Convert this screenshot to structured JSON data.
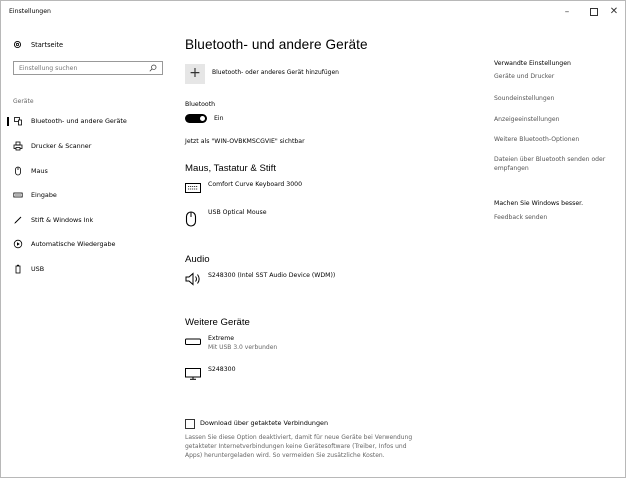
{
  "window": {
    "title": "Einstellungen",
    "controls": {
      "minimize": "–",
      "close": "✕"
    }
  },
  "sidebar": {
    "home_label": "Startseite",
    "search_placeholder": "Einstellung suchen",
    "section_label": "Geräte",
    "items": [
      {
        "label": "Bluetooth- und andere Geräte",
        "icon": "bluetooth-devices-icon",
        "selected": true
      },
      {
        "label": "Drucker & Scanner",
        "icon": "printer-icon",
        "selected": false
      },
      {
        "label": "Maus",
        "icon": "mouse-icon",
        "selected": false
      },
      {
        "label": "Eingabe",
        "icon": "keyboard-icon",
        "selected": false
      },
      {
        "label": "Stift & Windows Ink",
        "icon": "pen-icon",
        "selected": false
      },
      {
        "label": "Automatische Wiedergabe",
        "icon": "autoplay-icon",
        "selected": false
      },
      {
        "label": "USB",
        "icon": "usb-icon",
        "selected": false
      }
    ]
  },
  "main": {
    "title": "Bluetooth- und andere Geräte",
    "add_plus": "+",
    "add_label": "Bluetooth- oder anderes Gerät hinzufügen",
    "bluetooth_label": "Bluetooth",
    "bluetooth_state": "Ein",
    "visible_as": "Jetzt als \"WIN-OVBKMSCGVIE\" sichtbar",
    "sections": {
      "input": {
        "heading": "Maus, Tastatur & Stift",
        "devices": [
          {
            "name": "Comfort Curve Keyboard 3000",
            "icon": "keyboard-icon"
          },
          {
            "name": "USB Optical Mouse",
            "icon": "mouse-icon"
          }
        ]
      },
      "audio": {
        "heading": "Audio",
        "devices": [
          {
            "name": "S248300 (Intel SST Audio Device (WDM))",
            "icon": "speaker-icon"
          }
        ]
      },
      "other": {
        "heading": "Weitere Geräte",
        "devices": [
          {
            "name": "Extreme",
            "status": "Mit USB 3.0 verbunden",
            "icon": "drive-icon"
          },
          {
            "name": "S248300",
            "icon": "monitor-icon"
          }
        ]
      }
    },
    "metered": {
      "label": "Download über getaktete Verbindungen",
      "checked": false,
      "description": "Lassen Sie diese Option deaktiviert, damit für neue Geräte bei Verwendung getakteter Internetverbindungen keine Gerätesoftware (Treiber, Infos und Apps) heruntergeladen wird. So vermeiden Sie zusätzliche Kosten."
    }
  },
  "related": {
    "heading": "Verwandte Einstellungen",
    "links": [
      "Geräte und Drucker",
      "Soundeinstellungen",
      "Anzeigeeinstellungen",
      "Weitere Bluetooth-Optionen",
      "Dateien über Bluetooth senden oder empfangen"
    ],
    "feedback_heading": "Machen Sie Windows besser.",
    "feedback_link": "Feedback senden"
  },
  "colors": {
    "accent": "#000000",
    "link": "#555555",
    "secondary_text": "#666666",
    "button_bg": "#e6e6e6"
  }
}
